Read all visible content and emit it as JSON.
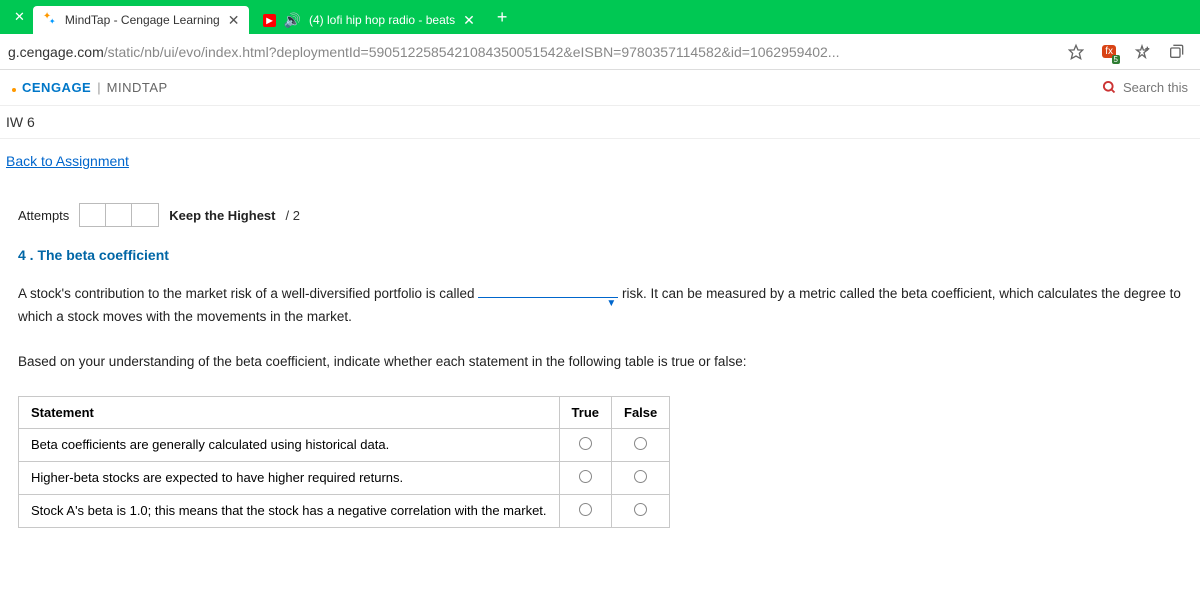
{
  "browser": {
    "tabs": [
      {
        "title": "MindTap - Cengage Learning",
        "active": true
      },
      {
        "title": "(4) lofi hip hop radio - beats",
        "active": false
      }
    ],
    "url_host": "g.cengage.com",
    "url_path": "/static/nb/ui/evo/index.html?deploymentId=5905122585421084350051542&eISBN=9780357114582&id=1062959402..."
  },
  "brand": {
    "cengage": "CENGAGE",
    "mindtap": "MINDTAP"
  },
  "search_placeholder": "Search this",
  "breadcrumb": "IW 6",
  "back_link": "Back to Assignment",
  "attempts": {
    "label": "Attempts",
    "keep_label": "Keep the Highest",
    "count": "/ 2"
  },
  "question": {
    "title": "4 . The beta coefficient",
    "para1_pre": "A stock's contribution to the market risk of a well-diversified portfolio is called ",
    "para1_post": " risk. It can be measured by a metric called the beta coefficient, which calculates the degree to which a stock moves with the movements in the market.",
    "para2": "Based on your understanding of the beta coefficient, indicate whether each statement in the following table is true or false:"
  },
  "table": {
    "h_statement": "Statement",
    "h_true": "True",
    "h_false": "False",
    "rows": [
      "Beta coefficients are generally calculated using historical data.",
      "Higher-beta stocks are expected to have higher required returns.",
      "Stock A's beta is 1.0; this means that the stock has a negative correlation with the market."
    ]
  }
}
